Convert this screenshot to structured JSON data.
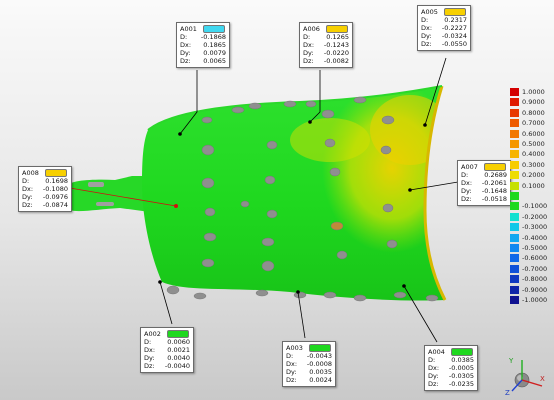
{
  "annotations": [
    {
      "id": "A001",
      "color": "#40d8f0",
      "D": "-0.1868",
      "Dx": "0.1865",
      "Dy": "0.0079",
      "Dz": "0.0065"
    },
    {
      "id": "A002",
      "color": "#1fd81f",
      "D": "0.0060",
      "Dx": "0.0021",
      "Dy": "0.0040",
      "Dz": "-0.0040"
    },
    {
      "id": "A003",
      "color": "#1fd81f",
      "D": "-0.0043",
      "Dx": "-0.0008",
      "Dy": "0.0035",
      "Dz": "0.0024"
    },
    {
      "id": "A004",
      "color": "#1fd81f",
      "D": "0.0385",
      "Dx": "-0.0005",
      "Dy": "-0.0305",
      "Dz": "-0.0235"
    },
    {
      "id": "A005",
      "color": "#f7d000",
      "D": "0.2317",
      "Dx": "-0.2227",
      "Dy": "-0.0324",
      "Dz": "-0.0550"
    },
    {
      "id": "A006",
      "color": "#f7d000",
      "D": "0.1265",
      "Dx": "-0.1243",
      "Dy": "-0.0220",
      "Dz": "-0.0082"
    },
    {
      "id": "A007",
      "color": "#f7d000",
      "D": "0.2689",
      "Dx": "-0.2061",
      "Dy": "-0.1648",
      "Dz": "-0.0518"
    },
    {
      "id": "A008",
      "color": "#f7d000",
      "D": "0.1698",
      "Dx": "-0.1080",
      "Dy": "-0.0976",
      "Dz": "-0.0874"
    }
  ],
  "fields": {
    "d": "D:",
    "dx": "Dx:",
    "dy": "Dy:",
    "dz": "Dz:"
  },
  "color_scale": [
    {
      "label": "1.0000",
      "color": "#d40000"
    },
    {
      "label": "0.9000",
      "color": "#e01a00"
    },
    {
      "label": "0.8000",
      "color": "#e83800"
    },
    {
      "label": "0.7000",
      "color": "#ee5a00"
    },
    {
      "label": "0.6000",
      "color": "#f27800"
    },
    {
      "label": "0.5000",
      "color": "#f59600"
    },
    {
      "label": "0.4000",
      "color": "#f7b400"
    },
    {
      "label": "0.3000",
      "color": "#f7cc00"
    },
    {
      "label": "0.2000",
      "color": "#eedc00"
    },
    {
      "label": "0.1000",
      "color": "#c6e000"
    },
    {
      "label": "",
      "color": "#1fd81f"
    },
    {
      "label": "-0.1000",
      "color": "#1fd81f"
    },
    {
      "label": "-0.2000",
      "color": "#10e0d0"
    },
    {
      "label": "-0.3000",
      "color": "#10c8e8"
    },
    {
      "label": "-0.4000",
      "color": "#10a8f0"
    },
    {
      "label": "-0.5000",
      "color": "#1088f0"
    },
    {
      "label": "-0.6000",
      "color": "#1068e8"
    },
    {
      "label": "-0.7000",
      "color": "#1050d8"
    },
    {
      "label": "-0.8000",
      "color": "#1038c0"
    },
    {
      "label": "-0.9000",
      "color": "#1024a8"
    },
    {
      "label": "-1.0000",
      "color": "#101290"
    }
  ],
  "axes": {
    "x": "X",
    "y": "Y",
    "z": "Z"
  }
}
